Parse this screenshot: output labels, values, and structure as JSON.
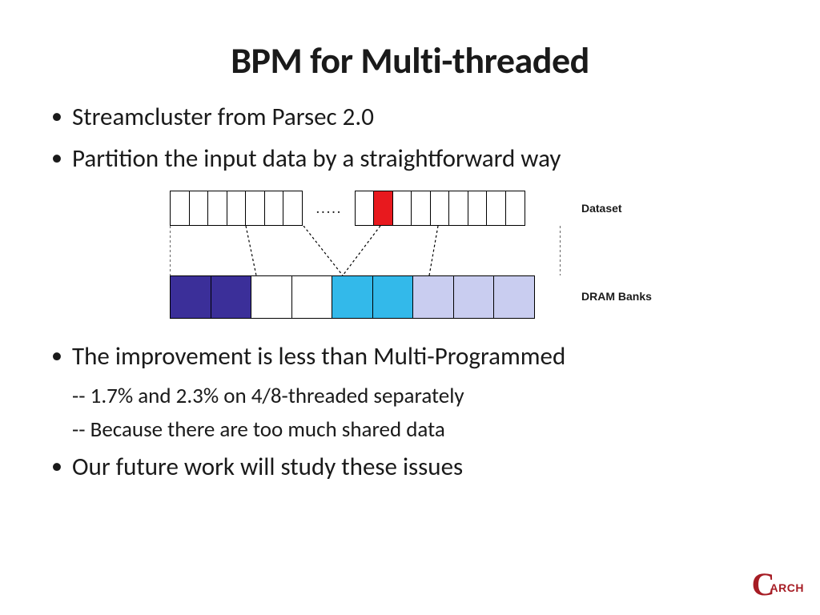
{
  "title": "BPM for Multi-threaded",
  "bullets": {
    "b1": "Streamcluster from Parsec 2.0",
    "b2": "Partition the input data by a straightforward way",
    "b3": "The improvement is less than Multi-Programmed",
    "b3_sub1": "-- 1.7% and 2.3% on 4/8-threaded separately",
    "b3_sub2": "-- Because there are too much shared data",
    "b4": "Our future work will study these issues"
  },
  "diagram": {
    "ellipsis": ".....",
    "label_dataset": "Dataset",
    "label_dram": "DRAM Banks",
    "dataset_cells": 17,
    "dataset_highlight_index": 9,
    "dram_groups": [
      {
        "color": "purple",
        "cells": 2
      },
      {
        "color": "white",
        "cells": 2
      },
      {
        "color": "cyan",
        "cells": 2
      },
      {
        "color": "lavender",
        "cells": 3
      }
    ]
  },
  "logo": {
    "letter": "C",
    "suffix": "ARCH"
  }
}
